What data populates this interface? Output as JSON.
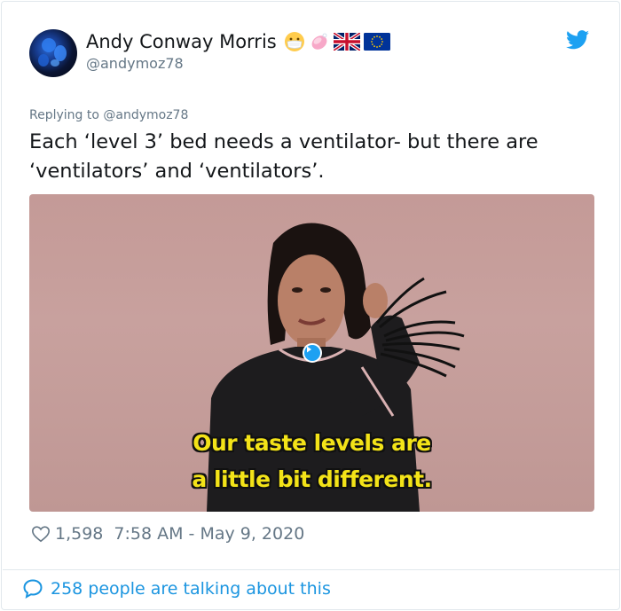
{
  "user": {
    "display_name": "Andy Conway Morris",
    "handle": "@andymoz78",
    "avatar": "avatar-image",
    "emoji": [
      "face-with-medical-mask",
      "soap",
      "flag-united-kingdom",
      "flag-european-union"
    ]
  },
  "reply": {
    "replying_to": "Replying to @andymoz78"
  },
  "tweet": {
    "text": "Each ‘level 3’ bed needs a ventilator- but there are ‘ventilators’ and ‘ventilators’."
  },
  "media": {
    "type": "gif",
    "caption_line1": "Our taste levels are",
    "caption_line2": "a little bit different."
  },
  "meta": {
    "likes": "1,598",
    "timestamp": "7:58 AM - May 9, 2020"
  },
  "footer": {
    "talking": "258 people are talking about this"
  },
  "colors": {
    "twitter_blue": "#1da1f2",
    "link_blue": "#1b95e0",
    "secondary_text": "#657786",
    "caption_yellow": "#f3e318"
  },
  "icons": {
    "brand": "twitter-bird-icon",
    "like": "heart-icon",
    "conversation": "speech-bubble-icon",
    "play": "play-icon"
  }
}
